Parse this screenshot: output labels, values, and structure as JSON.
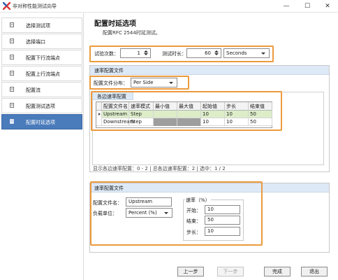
{
  "window": {
    "title": "非对称性能测试向导"
  },
  "nav": [
    {
      "label": "选择测试项",
      "active": false
    },
    {
      "label": "选择端口",
      "active": false
    },
    {
      "label": "配置下行流端点",
      "active": false
    },
    {
      "label": "配置上行流端点",
      "active": false
    },
    {
      "label": "配置流",
      "active": false
    },
    {
      "label": "配置测试选项",
      "active": false
    },
    {
      "label": "配置时延选项",
      "active": true
    }
  ],
  "header": {
    "title": "配置时延选项",
    "subtitle": "配置RFC 2544时延测试。"
  },
  "trial": {
    "count_label": "试验次数：",
    "count_value": "1",
    "duration_label": "测试时长：",
    "duration_value": "60",
    "unit": "Seconds"
  },
  "rate_profile": {
    "group_title": "速率配置文件",
    "distribution_label": "配置文件分布：",
    "distribution_value": "Per Side",
    "table_tab": "各边速率配置",
    "columns": [
      "配置文件名",
      "速率模式",
      "最小值",
      "最大值",
      "起始值",
      "步长",
      "结束值"
    ],
    "rows": [
      [
        "Upstream",
        "Step",
        "",
        "",
        "10",
        "10",
        "50"
      ],
      [
        "Downstream",
        "Step",
        "",
        "",
        "10",
        "10",
        "50"
      ]
    ],
    "status": "显示各边速率配置：0 - 2 | 总各边速率配置：2 | 选中：1 / 2"
  },
  "rate_file": {
    "group_title": "速率配置文件",
    "name_label": "配置文件名：",
    "name_value": "Upstream",
    "load_unit_label": "负载单位：",
    "load_unit_value": "Percent (%)",
    "rate_legend": "速率（%）",
    "start_label": "开始：",
    "start_value": "10",
    "end_label": "结束：",
    "end_value": "50",
    "step_label": "步长：",
    "step_value": "10"
  },
  "buttons": {
    "prev": "上一步",
    "next": "下一步",
    "finish": "完成",
    "exit": "退出"
  },
  "colors": {
    "accent": "#4a7bbb",
    "highlight": "#ec9a3d",
    "selected_row": "#dcedc8",
    "disabled_cell": "#9e9e9e"
  }
}
